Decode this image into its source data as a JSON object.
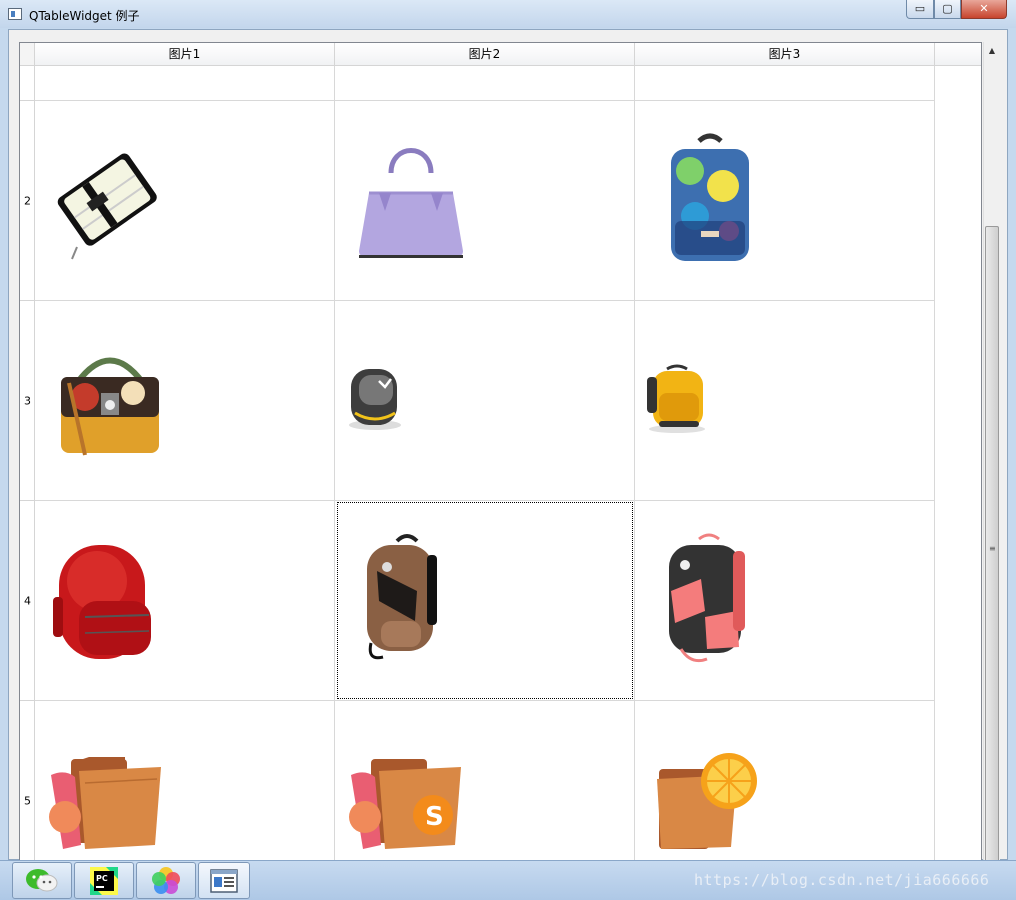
{
  "window": {
    "title": "QTableWidget 例子",
    "controls": {
      "minimize": "▭",
      "maximize": "▢",
      "close": "✕"
    }
  },
  "table": {
    "columns": [
      "图片1",
      "图片2",
      "图片3"
    ],
    "rows": [
      {
        "label": "",
        "cells": [
          "",
          "",
          ""
        ]
      },
      {
        "label": "2",
        "cells": [
          "clutch-wallet-icon",
          "purple-handbag-icon",
          "colorful-backpack-icon"
        ]
      },
      {
        "label": "3",
        "cells": [
          "colorful-satchel-icon",
          "gray-backpack-icon",
          "yellow-backpack-icon"
        ]
      },
      {
        "label": "4",
        "cells": [
          "red-backpack-icon",
          "brown-backpack-icon",
          "pink-black-backpack-icon"
        ]
      },
      {
        "label": "5",
        "cells": [
          "folder-photos-icon",
          "folder-sublime-icon",
          "folder-orange-icon"
        ]
      }
    ],
    "focused_cell": {
      "row": 3,
      "column": 1
    }
  },
  "taskbar": {
    "apps": [
      "wechat-icon",
      "pycharm-icon",
      "color-wheel-app-icon",
      "qt-table-window-icon"
    ]
  },
  "watermark": "https://blog.csdn.net/jia666666"
}
